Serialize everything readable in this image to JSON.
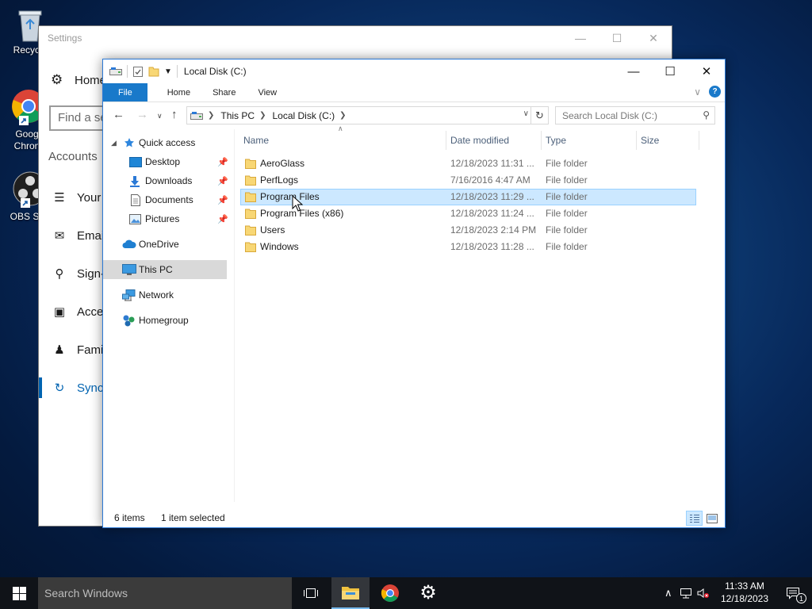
{
  "desktop": {
    "icons": [
      {
        "label": "Recycle"
      },
      {
        "label": "Goog",
        "label2": "Chron"
      },
      {
        "label": "OBS Stu"
      }
    ]
  },
  "settings": {
    "title": "Settings",
    "home_label": "Home",
    "search_placeholder": "Find a se",
    "section_title": "Accounts",
    "nav": [
      {
        "label": "Your",
        "icon": "person-card-icon"
      },
      {
        "label": "Email",
        "icon": "mail-icon"
      },
      {
        "label": "Sign-",
        "icon": "key-icon"
      },
      {
        "label": "Acces",
        "icon": "briefcase-icon"
      },
      {
        "label": "Famil",
        "icon": "people-icon"
      },
      {
        "label": "Sync",
        "icon": "sync-icon"
      }
    ],
    "active_nav_color": "#0063b1"
  },
  "explorer": {
    "title": "Local Disk (C:)",
    "ribbon_tabs": [
      {
        "label": "File"
      },
      {
        "label": "Home"
      },
      {
        "label": "Share"
      },
      {
        "label": "View"
      }
    ],
    "breadcrumb": [
      "This PC",
      "Local Disk (C:)"
    ],
    "search_placeholder": "Search Local Disk (C:)",
    "nav_pane": [
      {
        "label": "Quick access",
        "icon": "star-icon"
      },
      {
        "label": "Desktop",
        "icon": "desktop-folder-icon"
      },
      {
        "label": "Downloads",
        "icon": "download-icon"
      },
      {
        "label": "Documents",
        "icon": "document-icon"
      },
      {
        "label": "Pictures",
        "icon": "pictures-icon"
      },
      {
        "label": "OneDrive",
        "icon": "cloud-icon"
      },
      {
        "label": "This PC",
        "icon": "computer-icon"
      },
      {
        "label": "Network",
        "icon": "network-icon"
      },
      {
        "label": "Homegroup",
        "icon": "homegroup-icon"
      }
    ],
    "columns": {
      "name": "Name",
      "date": "Date modified",
      "type": "Type",
      "size": "Size"
    },
    "files": [
      {
        "name": "AeroGlass",
        "date": "12/18/2023 11:31 ...",
        "type": "File folder",
        "selected": false
      },
      {
        "name": "PerfLogs",
        "date": "7/16/2016 4:47 AM",
        "type": "File folder",
        "selected": false
      },
      {
        "name": "Program Files",
        "date": "12/18/2023 11:29 ...",
        "type": "File folder",
        "selected": true
      },
      {
        "name": "Program Files (x86)",
        "date": "12/18/2023 11:24 ...",
        "type": "File folder",
        "selected": false
      },
      {
        "name": "Users",
        "date": "12/18/2023 2:14 PM",
        "type": "File folder",
        "selected": false
      },
      {
        "name": "Windows",
        "date": "12/18/2023 11:28 ...",
        "type": "File folder",
        "selected": false
      }
    ],
    "status": {
      "count": "6 items",
      "selected": "1 item selected"
    },
    "accent": "#1979ca",
    "selection_bg": "#cce8ff"
  },
  "taskbar": {
    "search_placeholder": "Search Windows",
    "time": "11:33 AM",
    "date": "12/18/2023",
    "notification_count": "1"
  }
}
